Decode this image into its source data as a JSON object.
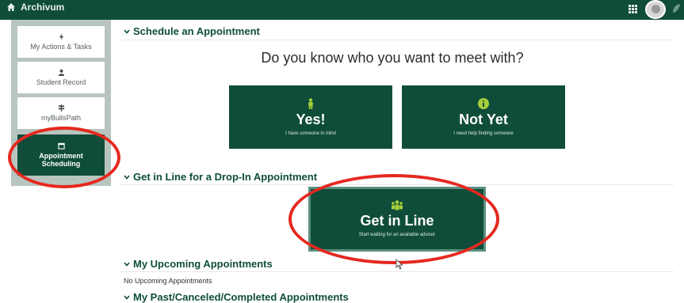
{
  "app": {
    "title": "Archivum"
  },
  "colors": {
    "brand_green": "#0f4d3a",
    "sidebar_bg": "#b8c5be",
    "accent_lime": "#a9cf3b",
    "annotation_red": "#e5281e"
  },
  "icons": {
    "home": "home-icon",
    "apps": "grid-icon",
    "leaf": "leaf-icon"
  },
  "sidebar": {
    "items": [
      {
        "label": "My Actions & Tasks",
        "icon": "bolt-icon",
        "active": false
      },
      {
        "label": "Student Record",
        "icon": "person-icon",
        "active": false
      },
      {
        "label": "myBullsPath",
        "icon": "signpost-icon",
        "active": false
      },
      {
        "label_line1": "Appointment",
        "label_line2": "Scheduling",
        "icon": "calendar-icon",
        "active": true
      }
    ]
  },
  "schedule": {
    "heading": "Schedule an Appointment",
    "question": "Do you know who you want to meet with?",
    "yes": {
      "title": "Yes!",
      "subtitle": "I have someone in mind",
      "icon": "person-icon"
    },
    "notyet": {
      "title": "Not Yet",
      "subtitle": "I need help finding someone",
      "icon": "info-icon"
    }
  },
  "dropin": {
    "heading": "Get in Line for a Drop-In Appointment",
    "button": {
      "title": "Get in Line",
      "subtitle": "Start waiting for an available advisor",
      "icon": "group-icon"
    }
  },
  "upcoming": {
    "heading": "My Upcoming Appointments",
    "empty_text": "No Upcoming Appointments"
  },
  "past": {
    "heading": "My Past/Canceled/Completed Appointments"
  }
}
